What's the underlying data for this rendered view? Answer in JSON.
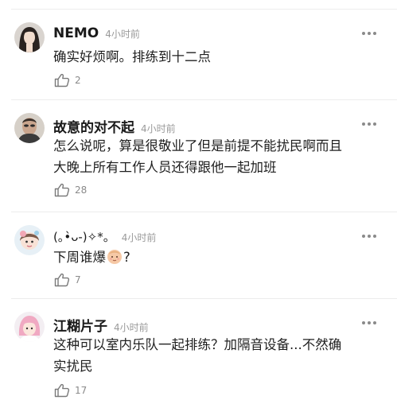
{
  "comments": [
    {
      "name": "NEMO",
      "time": "4小时前",
      "text_lines": [
        "确实好烦啊。排练到十二点"
      ],
      "likes": "2",
      "avatar": "girl-portrait-avatar"
    },
    {
      "name": "故意的对不起",
      "time": "4小时前",
      "text_lines": [
        "怎么说呢，算是很敬业了但是前提不能扰民啊而且",
        "大晚上所有工作人员还得跟他一起加班"
      ],
      "likes": "28",
      "avatar": "man-portrait-avatar"
    },
    {
      "name": "(｡•̀ᴗ-)✧*。",
      "time": "4小时前",
      "text_before_emoji": "下周谁爆",
      "emoji": "baby-face-emoji",
      "text_after_emoji": "?",
      "likes": "7",
      "avatar": "cartoon-girl-avatar"
    },
    {
      "name": "江糊片子",
      "time": "4小时前",
      "text_lines": [
        "这种可以室内乐队一起排练？加隔音设备...不然确",
        "实扰民"
      ],
      "likes": "17",
      "avatar": "pink-hair-avatar"
    }
  ],
  "colors": {
    "name": "#1a1a1a",
    "meta": "#9a9a9a",
    "text": "#1f1f1f",
    "divider": "#ececec"
  }
}
